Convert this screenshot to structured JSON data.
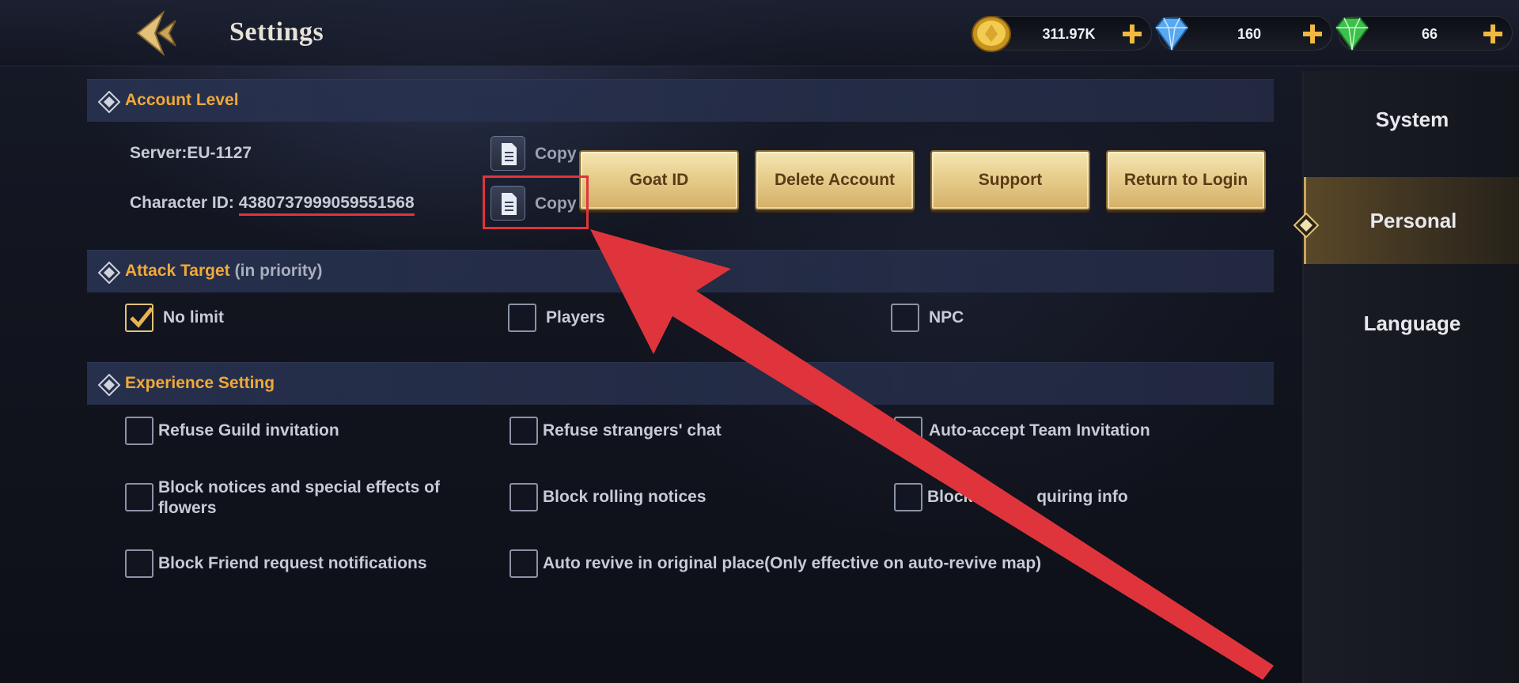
{
  "window": {
    "title": "Settings"
  },
  "currencies": [
    {
      "name": "gold-coin",
      "value": "311.97K",
      "color": "#e2b43c"
    },
    {
      "name": "blue-diamond",
      "value": "160",
      "color": "#58a8f0"
    },
    {
      "name": "green-gem",
      "value": "66",
      "color": "#3cc04c"
    }
  ],
  "account": {
    "header": "Account Level",
    "server_label": "Server:EU-1127",
    "character_id_prefix": "Character ID:",
    "character_id": "4380737999059551568",
    "copy_label": "Copy",
    "buttons": {
      "goat_id": "Goat ID",
      "delete_account": "Delete Account",
      "support": "Support",
      "return_login": "Return to Login"
    }
  },
  "attack": {
    "header": "Attack Target",
    "subtitle": "(in priority)",
    "options": [
      {
        "label": "No limit",
        "checked": true
      },
      {
        "label": "Players",
        "checked": false
      },
      {
        "label": "NPC",
        "checked": false
      }
    ]
  },
  "experience": {
    "header": "Experience Setting",
    "options": [
      {
        "label": "Refuse Guild invitation",
        "checked": false
      },
      {
        "label": "Refuse strangers' chat",
        "checked": false
      },
      {
        "label": "Auto-accept Team Invitation",
        "checked": false
      },
      {
        "label_line1": "Block notices and special effects of",
        "label_line2": "flowers",
        "checked": false
      },
      {
        "label": "Block rolling notices",
        "checked": false
      },
      {
        "label_a": "Block B",
        "label_b": "quiring info",
        "checked": false
      },
      {
        "label": "Block Friend request notifications",
        "checked": false
      },
      {
        "label": "Auto revive in original place(Only effective on auto-revive map)",
        "checked": false
      }
    ]
  },
  "sidebar": {
    "items": [
      {
        "label": "System",
        "active": false
      },
      {
        "label": "Personal",
        "active": true
      },
      {
        "label": "Language",
        "active": false
      }
    ]
  },
  "annotation": {
    "color": "#e0343c"
  }
}
